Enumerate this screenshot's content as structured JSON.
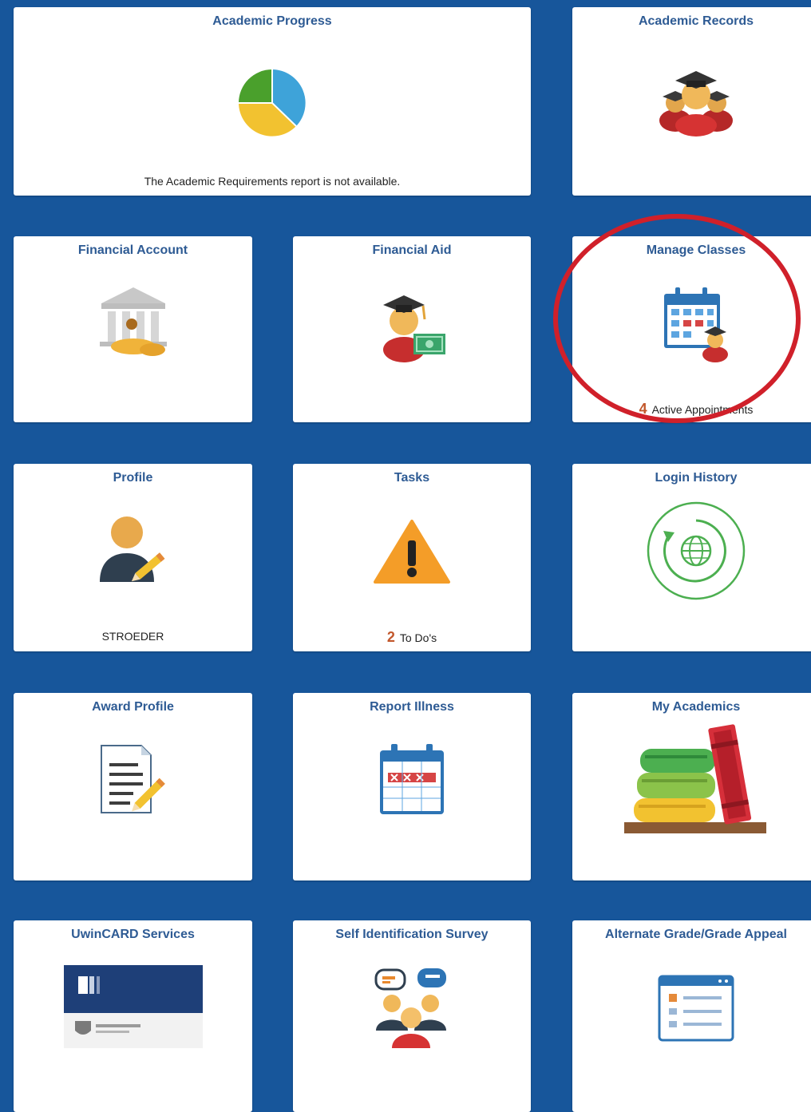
{
  "tiles": {
    "academic_progress": {
      "title": "Academic Progress",
      "footer": "The Academic Requirements report is not available.",
      "icon": "pie-chart-icon",
      "colors": [
        "#3ea3d9",
        "#f2c230",
        "#4aa02c"
      ]
    },
    "academic_records": {
      "title": "Academic Records",
      "icon": "graduates-icon"
    },
    "financial_account": {
      "title": "Financial Account",
      "icon": "bank-icon"
    },
    "financial_aid": {
      "title": "Financial Aid",
      "icon": "graduate-money-icon"
    },
    "manage_classes": {
      "title": "Manage Classes",
      "icon": "calendar-student-icon",
      "count": "4",
      "footer": "Active Appointments"
    },
    "profile": {
      "title": "Profile",
      "icon": "user-edit-icon",
      "footer": "STROEDER"
    },
    "tasks": {
      "title": "Tasks",
      "icon": "warning-icon",
      "count": "2",
      "footer": "To Do's"
    },
    "login_history": {
      "title": "Login History",
      "icon": "globe-refresh-icon"
    },
    "award_profile": {
      "title": "Award Profile",
      "icon": "document-edit-icon"
    },
    "report_illness": {
      "title": "Report Illness",
      "icon": "calendar-x-icon"
    },
    "my_academics": {
      "title": "My Academics",
      "icon": "books-icon"
    },
    "uwincard_services": {
      "title": "UwinCARD Services",
      "icon": "id-card-icon"
    },
    "self_identification_survey": {
      "title": "Self Identification Survey",
      "icon": "people-chat-icon"
    },
    "alternate_grade_appeal": {
      "title": "Alternate Grade/Grade Appeal",
      "icon": "form-window-icon"
    }
  },
  "colors": {
    "background": "#17569b",
    "title": "#2e5b94",
    "count": "#c2572b",
    "highlight": "#d0202a"
  }
}
